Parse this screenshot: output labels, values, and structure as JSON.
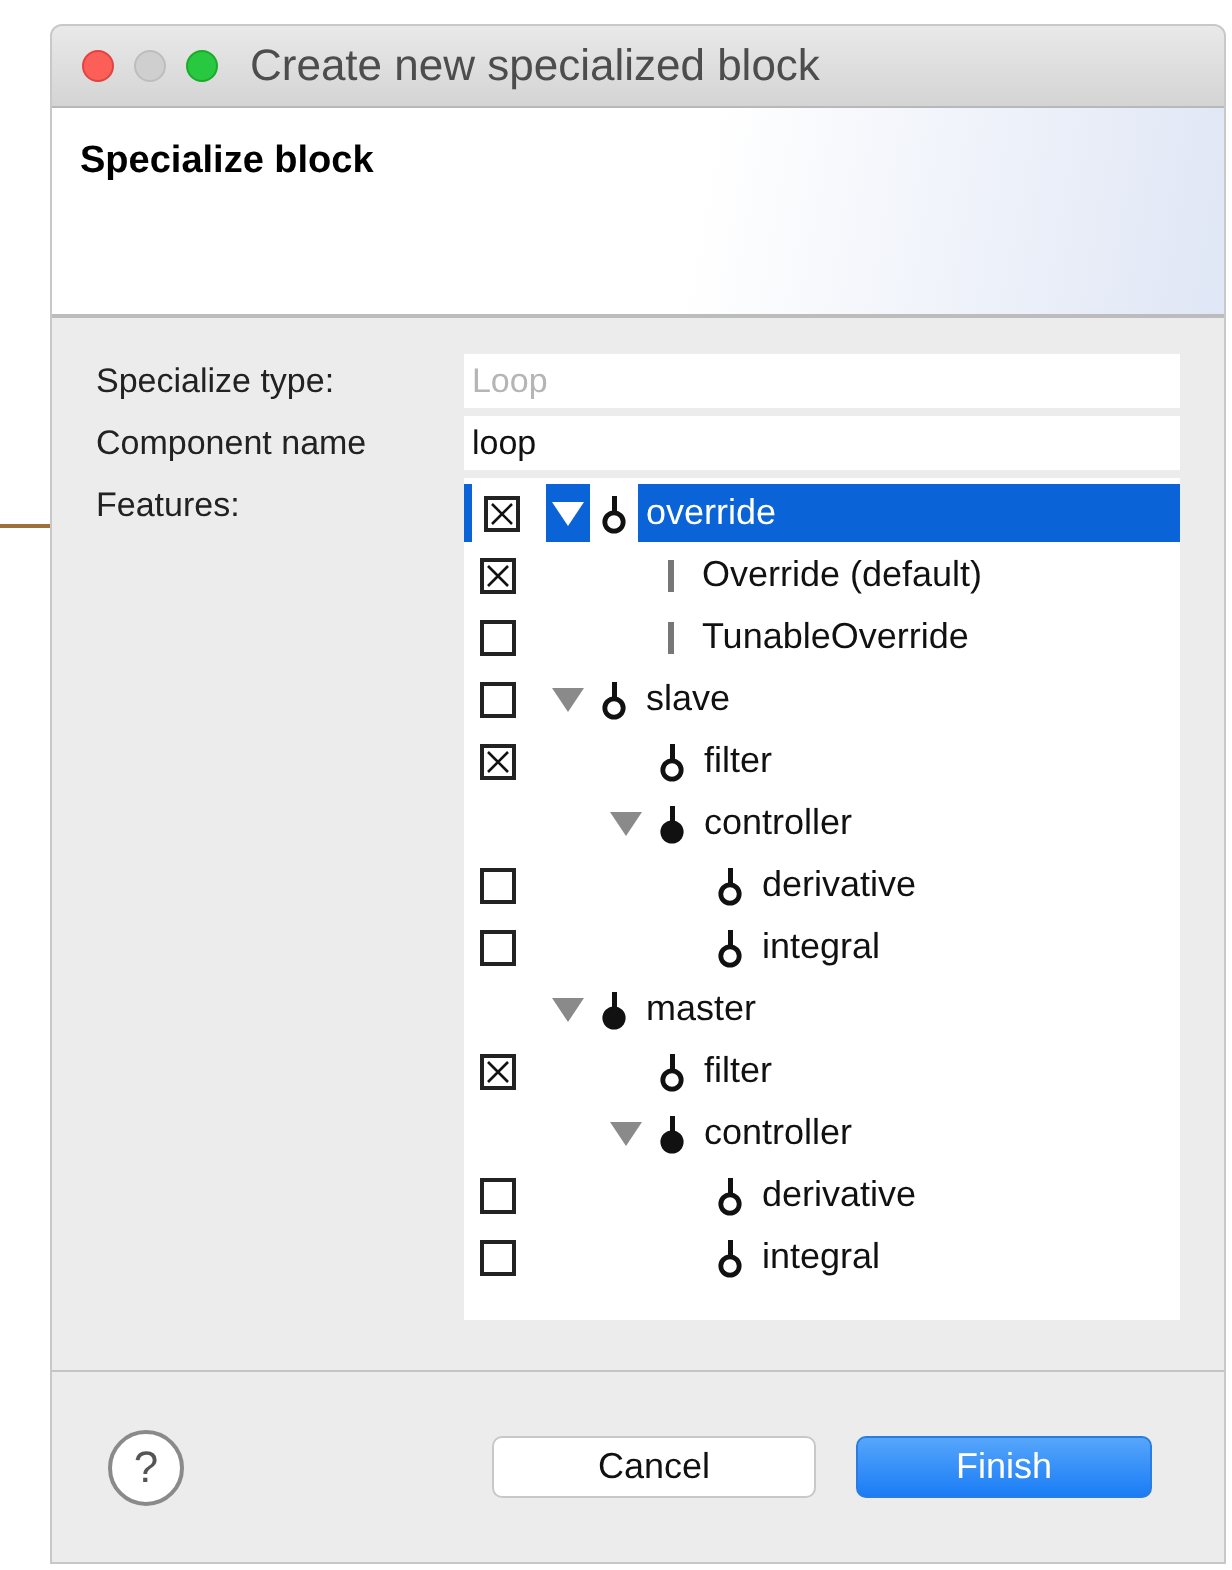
{
  "window": {
    "title": "Create new specialized block"
  },
  "header": {
    "title": "Specialize block"
  },
  "form": {
    "specialize_type": {
      "label": "Specialize type:",
      "placeholder": "Loop"
    },
    "component_name": {
      "label": "Component name",
      "value": "loop"
    },
    "features_label": "Features:"
  },
  "features": [
    {
      "label": "override",
      "kind": "open",
      "checked": true,
      "expanded": true,
      "selected": true,
      "children": [
        {
          "label": "Override (default)",
          "kind": "bar",
          "checked": true,
          "selected": false
        },
        {
          "label": "TunableOverride",
          "kind": "bar",
          "checked": false,
          "selected": false
        }
      ]
    },
    {
      "label": "slave",
      "kind": "open",
      "checked": false,
      "expanded": true,
      "selected": false,
      "children": [
        {
          "label": "filter",
          "kind": "open",
          "checked": true,
          "selected": false
        },
        {
          "label": "controller",
          "kind": "filled",
          "expanded": true,
          "selected": false,
          "children": [
            {
              "label": "derivative",
              "kind": "open",
              "checked": false,
              "selected": false
            },
            {
              "label": "integral",
              "kind": "open",
              "checked": false,
              "selected": false
            }
          ]
        }
      ]
    },
    {
      "label": "master",
      "kind": "filled",
      "expanded": true,
      "selected": false,
      "children": [
        {
          "label": "filter",
          "kind": "open",
          "checked": true,
          "selected": false
        },
        {
          "label": "controller",
          "kind": "filled",
          "expanded": true,
          "selected": false,
          "children": [
            {
              "label": "derivative",
              "kind": "open",
              "checked": false,
              "selected": false
            },
            {
              "label": "integral",
              "kind": "open",
              "checked": false,
              "selected": false
            }
          ]
        }
      ]
    }
  ],
  "buttons": {
    "help": "?",
    "cancel": "Cancel",
    "finish": "Finish"
  }
}
